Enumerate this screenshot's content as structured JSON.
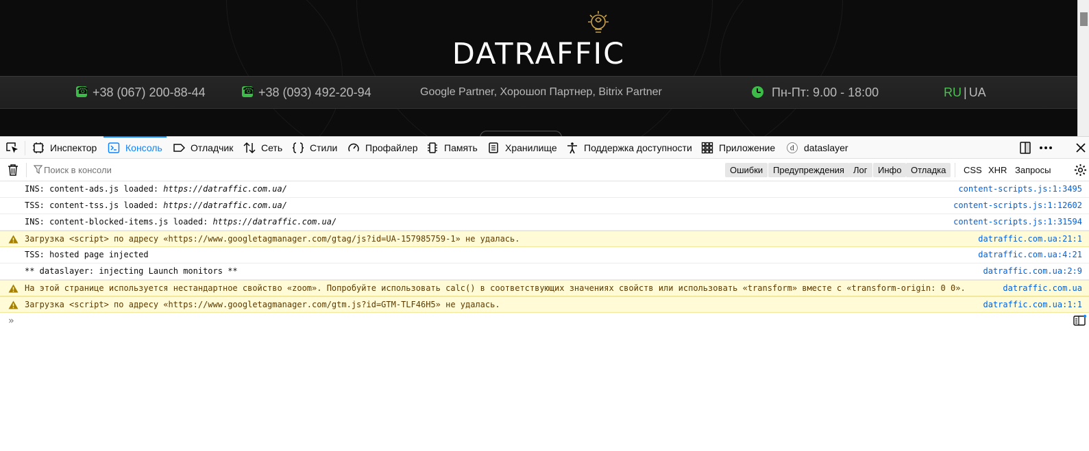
{
  "site": {
    "logo_text": "DATRAFFIC",
    "phone1": "+38 (067) 200-88-44",
    "phone2": "+38 (093) 492-20-94",
    "partners": "Google Partner, Хорошоп Партнер, Bitrix Partner",
    "hours": "Пн-Пт: 9.00 - 18:00",
    "lang_ru": "RU",
    "lang_sep": "|",
    "lang_ua": "UA",
    "icons": {
      "phone": "phone-icon",
      "clock": "clock-icon",
      "logo": "lightbulb-logo-icon"
    },
    "colors": {
      "background": "#0c0c0c",
      "accent": "#3dbb48"
    }
  },
  "devtools": {
    "tabs": [
      {
        "label": "Инспектор",
        "icon": "inspector-icon"
      },
      {
        "label": "Консоль",
        "icon": "console-icon",
        "selected": true
      },
      {
        "label": "Отладчик",
        "icon": "debugger-icon"
      },
      {
        "label": "Сеть",
        "icon": "network-icon"
      },
      {
        "label": "Стили",
        "icon": "style-editor-icon"
      },
      {
        "label": "Профайлер",
        "icon": "profiler-icon"
      },
      {
        "label": "Память",
        "icon": "memory-icon"
      },
      {
        "label": "Хранилище",
        "icon": "storage-icon"
      },
      {
        "label": "Поддержка доступности",
        "icon": "accessibility-icon"
      },
      {
        "label": "Приложение",
        "icon": "application-icon"
      },
      {
        "label": "dataslayer",
        "icon": "dataslayer-icon"
      }
    ],
    "accent": "#0a84ff",
    "filter": {
      "placeholder": "Поиск в консоли",
      "levels": [
        "Ошибки",
        "Предупреждения",
        "Лог",
        "Инфо",
        "Отладка"
      ],
      "types": [
        "CSS",
        "XHR",
        "Запросы"
      ]
    },
    "messages": [
      {
        "type": "log",
        "prefix": "INS: content-ads.js loaded:  ",
        "url": "https://datraffic.com.ua/",
        "source": "content-scripts.js:1:3495"
      },
      {
        "type": "log",
        "prefix": "TSS: content-tss.js loaded:  ",
        "url": "https://datraffic.com.ua/",
        "source": "content-scripts.js:1:12602"
      },
      {
        "type": "log",
        "prefix": "INS: content-blocked-items.js loaded:  ",
        "url": "https://datraffic.com.ua/",
        "source": "content-scripts.js:1:31594"
      },
      {
        "type": "warn",
        "prefix": "Загрузка <script> по адресу «https://www.googletagmanager.com/gtag/js?id=UA-157985759-1» не удалась.",
        "url": "",
        "source": "datraffic.com.ua:21:1"
      },
      {
        "type": "log",
        "prefix": "TSS: hosted page injected",
        "url": "",
        "source": "datraffic.com.ua:4:21"
      },
      {
        "type": "log",
        "prefix": "** dataslayer: injecting Launch monitors **",
        "url": "",
        "source": "datraffic.com.ua:2:9"
      },
      {
        "type": "warn",
        "prefix": "На этой странице используется нестандартное свойство «zoom». Попробуйте использовать calc() в соответствующих значениях свойств или использовать «transform» вместе с «transform-origin: 0 0».",
        "url": "",
        "source": "datraffic.com.ua"
      },
      {
        "type": "warn",
        "prefix": "Загрузка <script> по адресу «https://www.googletagmanager.com/gtm.js?id=GTM-TLF46H5» не удалась.",
        "url": "",
        "source": "datraffic.com.ua:1:1"
      }
    ],
    "prompt": "»"
  }
}
